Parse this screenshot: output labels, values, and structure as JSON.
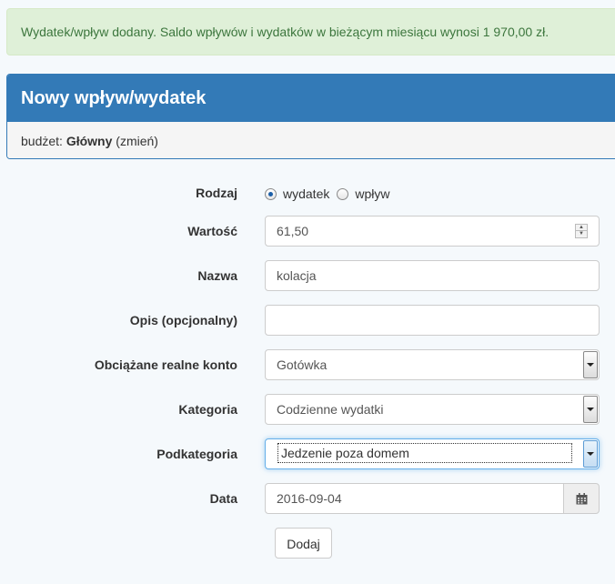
{
  "alert": {
    "message": "Wydatek/wpływ dodany. Saldo wpływów i wydatków w bieżącym miesiącu wynosi 1 970,00 zł."
  },
  "panel": {
    "title": "Nowy wpływ/wydatek",
    "budget_prefix": "budżet:",
    "budget_name": "Główny",
    "budget_change": "(zmień)"
  },
  "form": {
    "type": {
      "label": "Rodzaj",
      "options": [
        "wydatek",
        "wpływ"
      ],
      "selected": "wydatek"
    },
    "amount": {
      "label": "Wartość",
      "value": "61,50"
    },
    "name": {
      "label": "Nazwa",
      "value": "kolacja"
    },
    "description": {
      "label": "Opis (opcjonalny)",
      "value": ""
    },
    "account": {
      "label": "Obciążane realne konto",
      "value": "Gotówka"
    },
    "category": {
      "label": "Kategoria",
      "value": "Codzienne wydatki"
    },
    "subcategory": {
      "label": "Podkategoria",
      "value": "Jedzenie poza domem"
    },
    "date": {
      "label": "Data",
      "value": "2016-09-04"
    },
    "submit_label": "Dodaj"
  },
  "colors": {
    "panel_primary": "#337ab7",
    "alert_bg": "#dff0d8",
    "alert_text": "#3c763d",
    "page_bg": "#f5f9fc"
  }
}
